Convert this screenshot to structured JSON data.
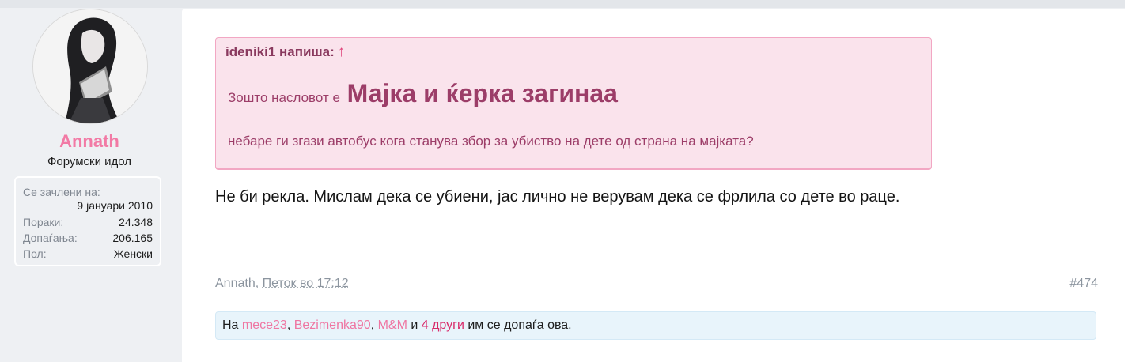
{
  "user": {
    "name": "Annath",
    "title": "Форумски идол",
    "stats": {
      "joined_label": "Се зачлени на:",
      "joined_value": "9 јануари 2010",
      "posts_label": "Пораки:",
      "posts_value": "24.348",
      "likes_label": "Допаѓања:",
      "likes_value": "206.165",
      "gender_label": "Пол:",
      "gender_value": "Женски"
    }
  },
  "quote": {
    "author": "ideniki1 напиша:",
    "arrow": "↑",
    "line1_prefix": "Зошто насловот е",
    "line1_big": "Мајка и ќерка загинаа",
    "line2": "небаре ги згази автобус кога станува збор за убиство на дете од страна на мајката?"
  },
  "message": "Не би рекла. Мислам дека се убиени, јас лично не верувам дека се фрлила со дете во раце.",
  "meta": {
    "author": "Annath",
    "sep": ", ",
    "date": "Петок во 17:12",
    "post_number": "#474"
  },
  "likes": {
    "prefix": "На",
    "users": [
      "mece23",
      "Bezimenka90",
      "M&M"
    ],
    "and": "и",
    "more": "4 други",
    "suffix": "им се допаѓа ова."
  },
  "colors": {
    "username": "#f27aa5",
    "quote_bg": "#fae3ec",
    "quote_text": "#9c3d68",
    "likes_bg": "#e8f4fb"
  }
}
